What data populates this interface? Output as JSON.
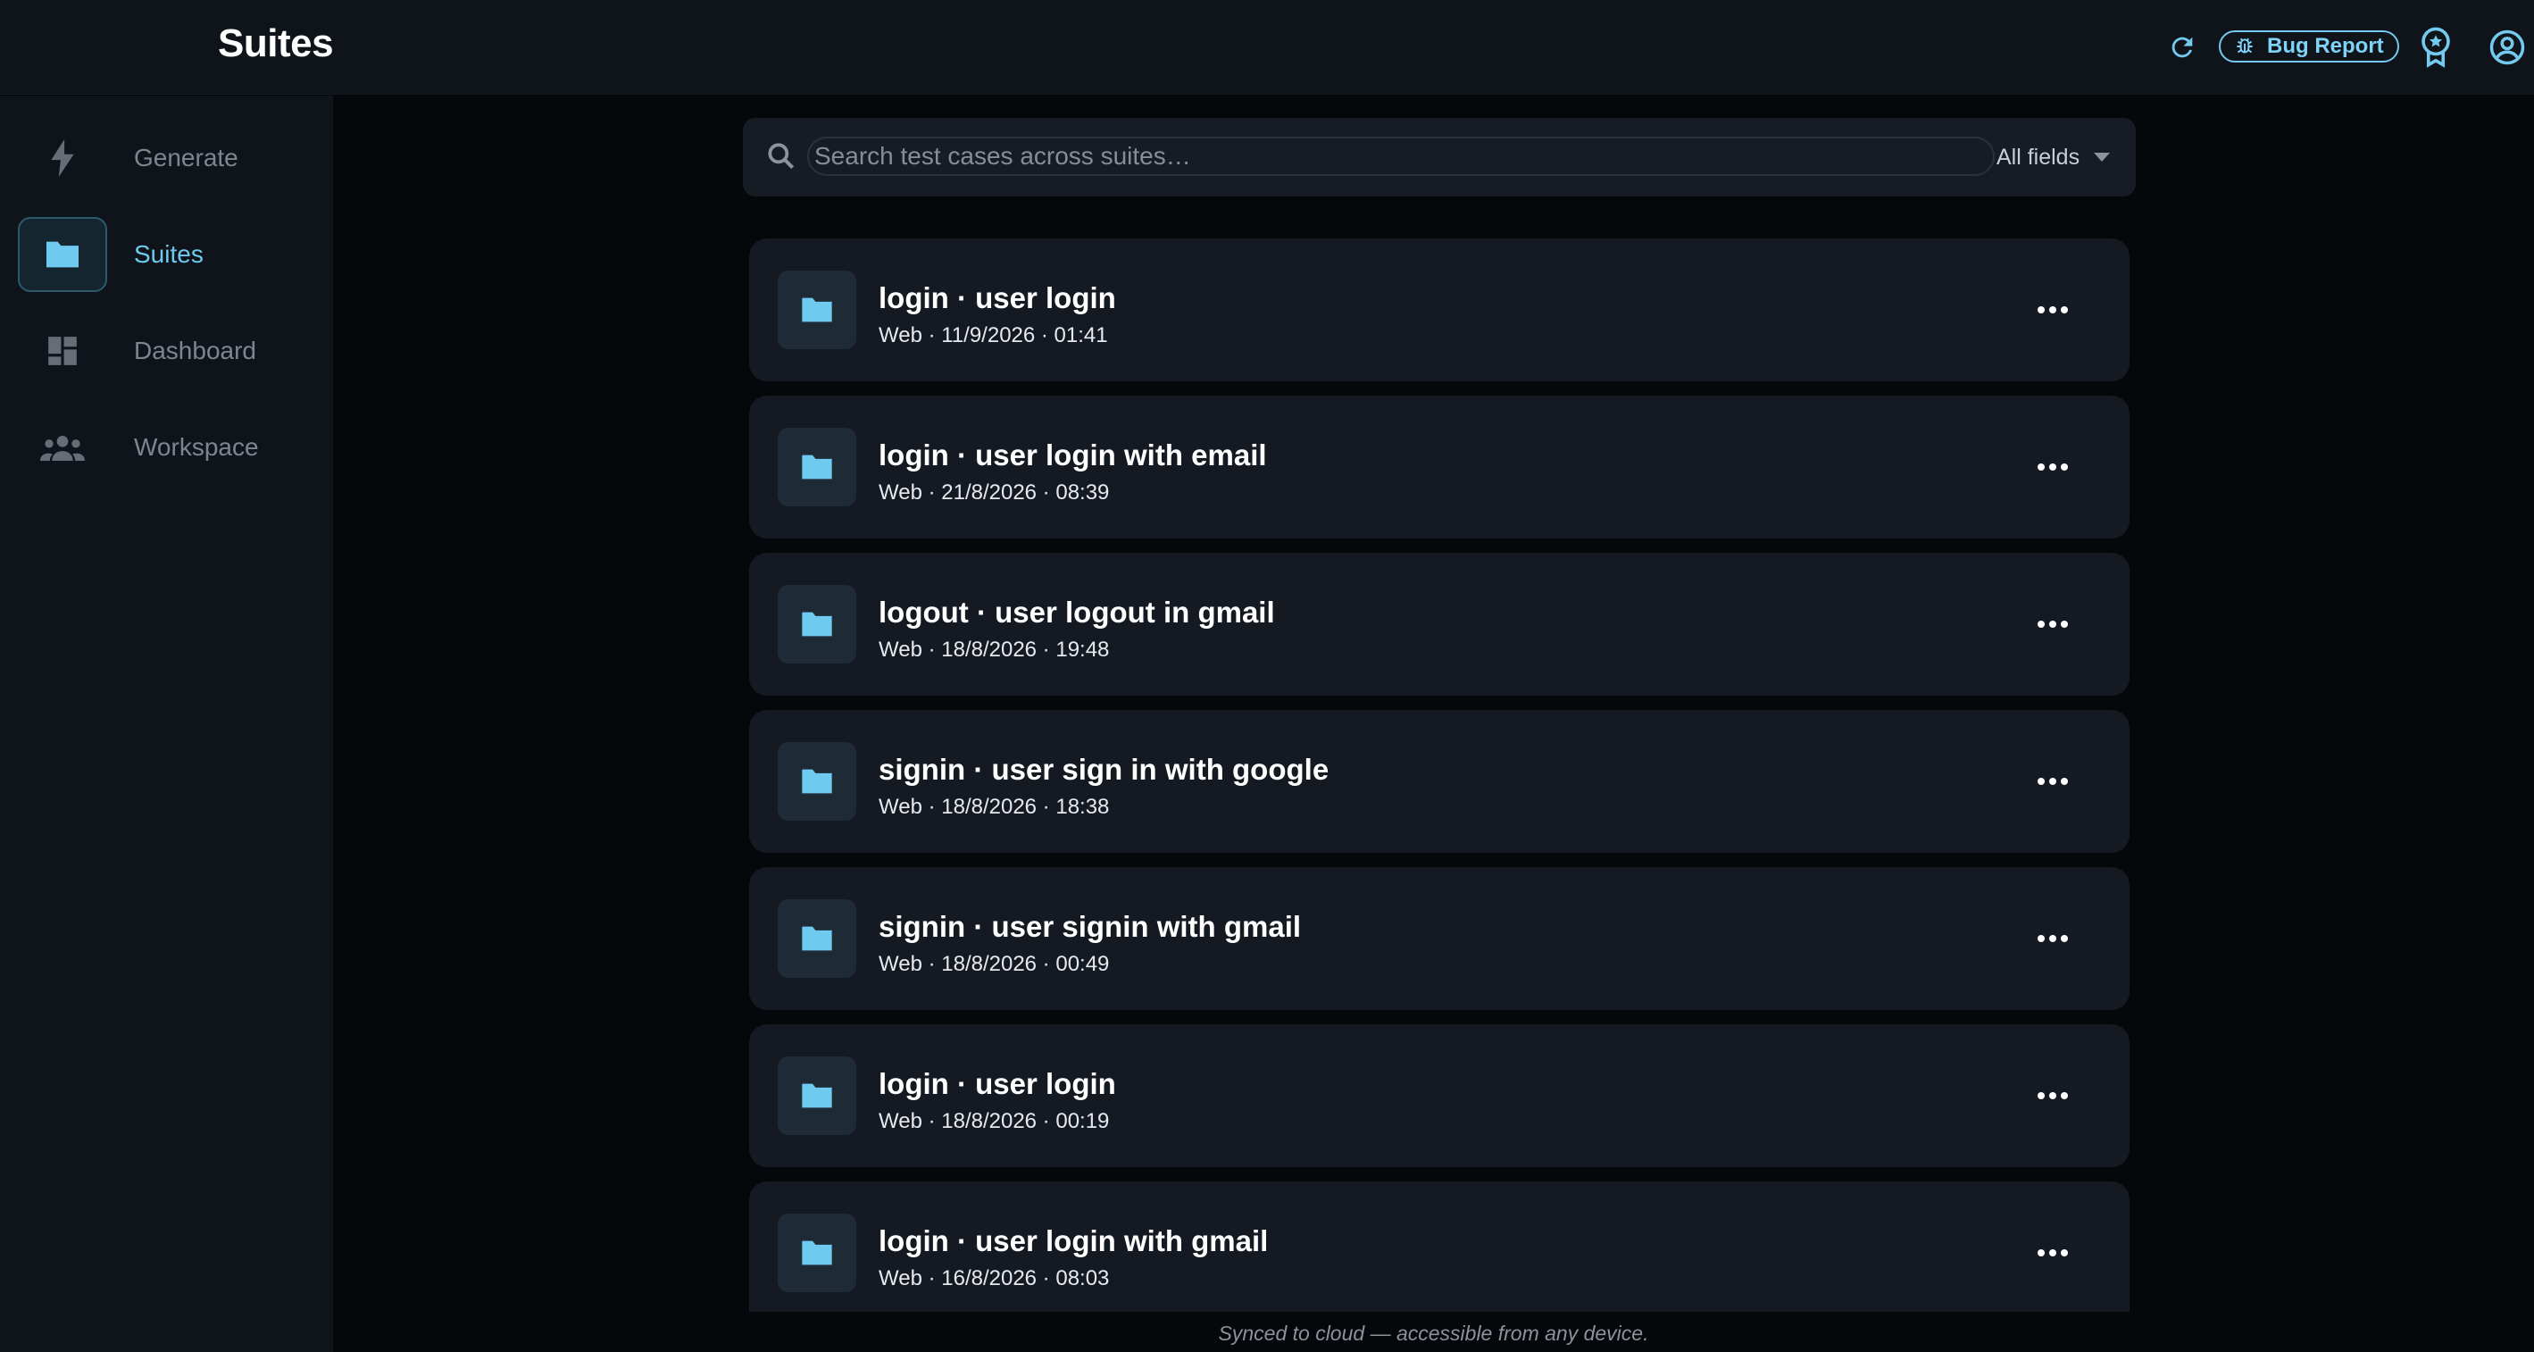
{
  "header": {
    "title": "Suites",
    "bug_report_label": "Bug Report",
    "icons": [
      "refresh-icon",
      "bug-icon",
      "award-icon",
      "account-circle-icon"
    ]
  },
  "sidebar": {
    "items": [
      {
        "label": "Generate",
        "icon": "bolt-icon",
        "active": false
      },
      {
        "label": "Suites",
        "icon": "folder-icon",
        "active": true
      },
      {
        "label": "Dashboard",
        "icon": "dashboard-icon",
        "active": false
      },
      {
        "label": "Workspace",
        "icon": "group-icon",
        "active": false
      }
    ]
  },
  "search": {
    "placeholder": "Search test cases across suites…",
    "value": "",
    "filter_label": "All fields"
  },
  "suites": [
    {
      "title": "login · user login",
      "meta": "Web · 11/9/2026 · 01:41"
    },
    {
      "title": "login · user login with email",
      "meta": "Web · 21/8/2026 · 08:39"
    },
    {
      "title": "logout · user logout in gmail",
      "meta": "Web · 18/8/2026 · 19:48"
    },
    {
      "title": "signin · user sign in with google",
      "meta": "Web · 18/8/2026 · 18:38"
    },
    {
      "title": "signin · user signin with gmail",
      "meta": "Web · 18/8/2026 · 00:49"
    },
    {
      "title": "login · user login",
      "meta": "Web · 18/8/2026 · 00:19"
    },
    {
      "title": "login · user login with gmail",
      "meta": "Web · 16/8/2026 · 08:03"
    }
  ],
  "footer": {
    "note": "Synced to cloud — accessible from any device."
  },
  "colors": {
    "accent": "#6fcaf0",
    "topbar_bg": "#0f141b",
    "page_bg": "#05070a",
    "card_bg": "#151a22"
  }
}
